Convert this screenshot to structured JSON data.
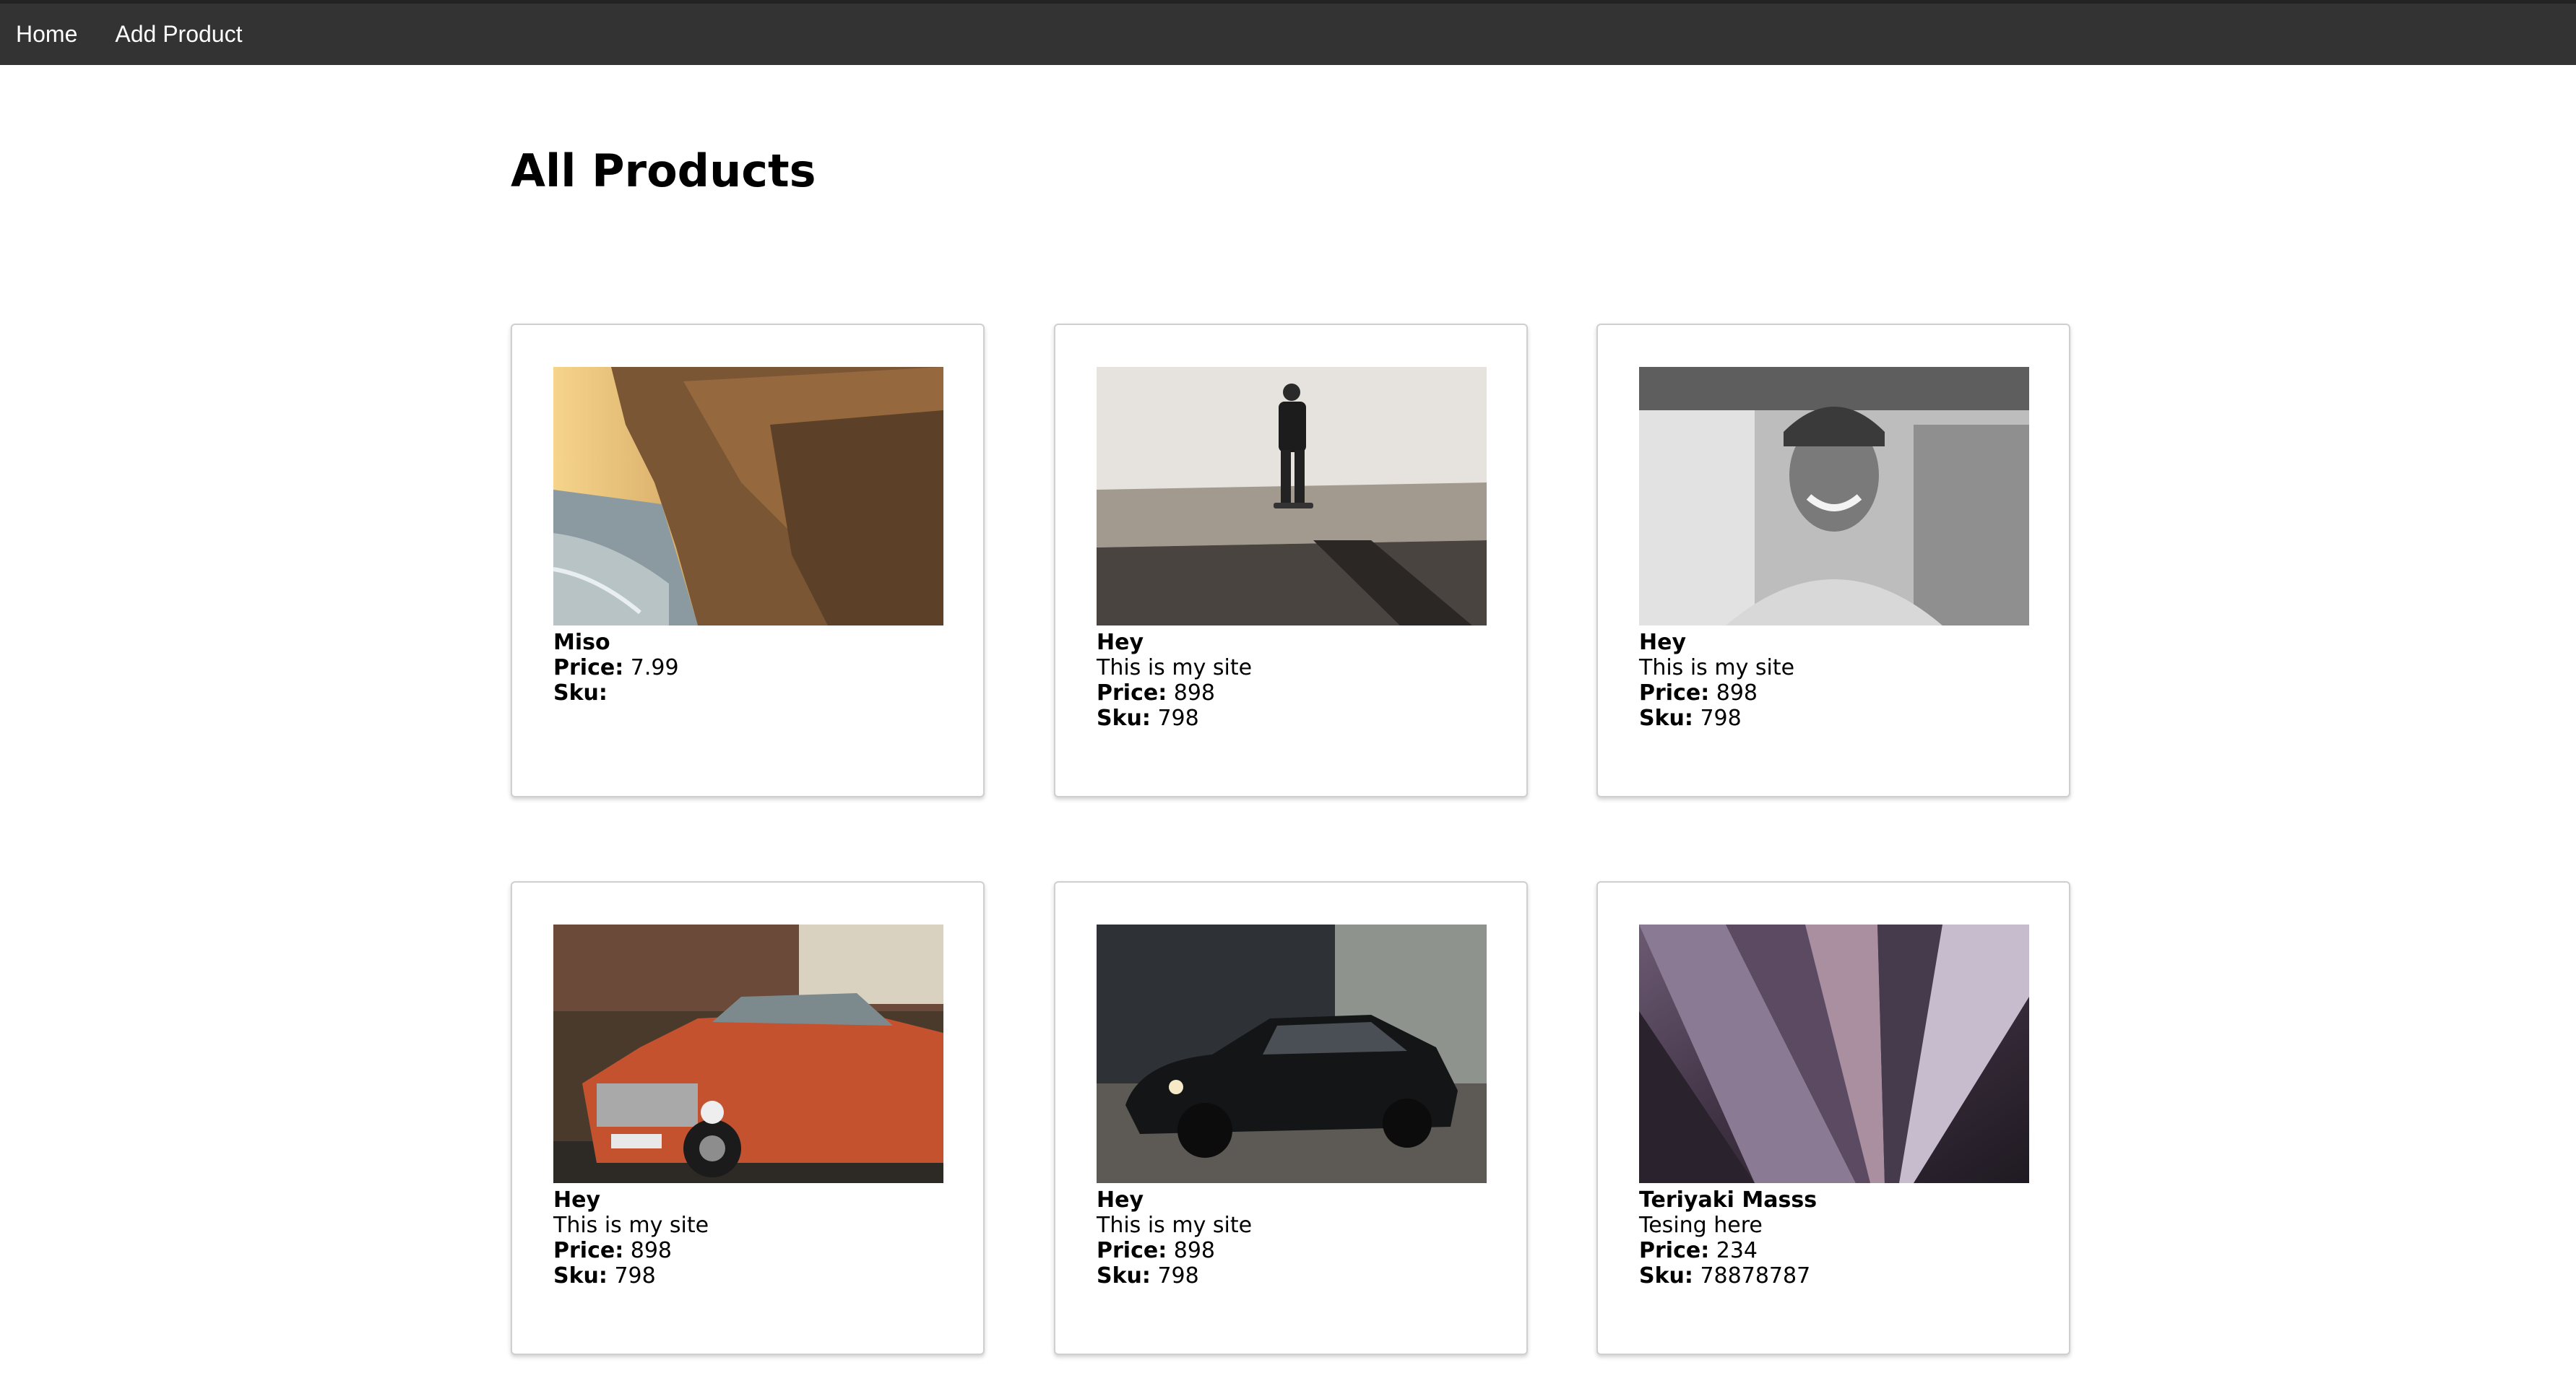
{
  "nav": {
    "home": "Home",
    "add_product": "Add Product"
  },
  "page": {
    "title": "All Products"
  },
  "labels": {
    "price": "Price:",
    "sku": "Sku:"
  },
  "products": [
    {
      "name": "Miso",
      "description": "",
      "price": "7.99",
      "sku": "",
      "image": "coastal cliffs at sunset"
    },
    {
      "name": "Hey",
      "description": "This is my site",
      "price": "898",
      "sku": "798",
      "image": "skateboarder on a ledge"
    },
    {
      "name": "Hey",
      "description": "This is my site",
      "price": "898",
      "sku": "798",
      "image": "smiling man in cap, black and white"
    },
    {
      "name": "Hey",
      "description": "This is my site",
      "price": "898",
      "sku": "798",
      "image": "vintage orange car"
    },
    {
      "name": "Hey",
      "description": "This is my site",
      "price": "898",
      "sku": "798",
      "image": "black sports coupe"
    },
    {
      "name": "Teriyaki Masss",
      "description": "Tesing here",
      "price": "234",
      "sku": "78878787",
      "image": "abstract folded purple sheets"
    }
  ]
}
